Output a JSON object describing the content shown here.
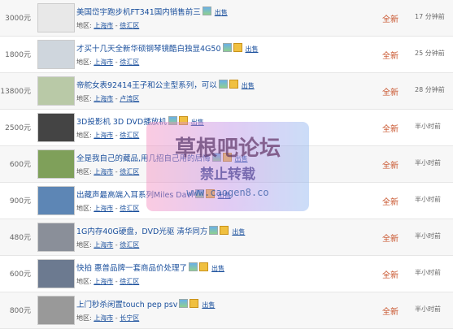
{
  "listings": [
    {
      "price": "3000元",
      "title": "美国岱宇跑步机FT341国内销售前三",
      "seller": "出售",
      "region_label": "地区:",
      "city": "上海市",
      "district": "徐汇区",
      "condition": "全新",
      "time": "17 分钟前",
      "map": false
    },
    {
      "price": "1800元",
      "title": "才买十几天全新华硕钢琴镜酷白独显4G50",
      "seller": "出售",
      "region_label": "地区:",
      "city": "上海市",
      "district": "徐汇区",
      "condition": "全新",
      "time": "25 分钟前",
      "map": true
    },
    {
      "price": "13800元",
      "title": "帝舵女表92414王子和公主型系列，可以",
      "seller": "出售",
      "region_label": "地区:",
      "city": "上海市",
      "district": "卢湾区",
      "condition": "全新",
      "time": "28 分钟前",
      "map": true
    },
    {
      "price": "2500元",
      "title": "3D投影机 3D DVD播放机",
      "seller": "出售",
      "region_label": "地区:",
      "city": "上海市",
      "district": "徐汇区",
      "condition": "全新",
      "time": "半小时前",
      "map": true
    },
    {
      "price": "600元",
      "title": "全是我自己的藏品,用几招自己用的后悔",
      "seller": "出售",
      "region_label": "地区:",
      "city": "上海市",
      "district": "徐汇区",
      "condition": "全新",
      "time": "半小时前",
      "map": true
    },
    {
      "price": "900元",
      "title": "出藏声最高端入耳系列Miles Davi",
      "seller": "出售",
      "region_label": "地区:",
      "city": "上海市",
      "district": "徐汇区",
      "condition": "全新",
      "time": "半小时前",
      "map": true
    },
    {
      "price": "480元",
      "title": "1G内存40G硬盘，DVD光驱 清华同方",
      "seller": "出售",
      "region_label": "地区:",
      "city": "上海市",
      "district": "徐汇区",
      "condition": "全新",
      "time": "半小时前",
      "map": true
    },
    {
      "price": "600元",
      "title": "快拍 惠普品牌一套商品价处理了",
      "seller": "出售",
      "region_label": "地区:",
      "city": "上海市",
      "district": "徐汇区",
      "condition": "全新",
      "time": "半小时前",
      "map": true
    },
    {
      "price": "800元",
      "title": "上门秒杀闲置touch pep psv",
      "seller": "出售",
      "region_label": "地区:",
      "city": "上海市",
      "district": "长宁区",
      "condition": "全新",
      "time": "半小时前",
      "map": true
    }
  ],
  "watermark": {
    "line1": "草根吧论坛",
    "line2": "禁止转载",
    "line3": "www.caogen8.co"
  },
  "icons": {
    "picture": "picture-icon",
    "map": "map-icon"
  },
  "colors": {
    "link": "#1a4f9c",
    "condition": "#c8532b"
  }
}
